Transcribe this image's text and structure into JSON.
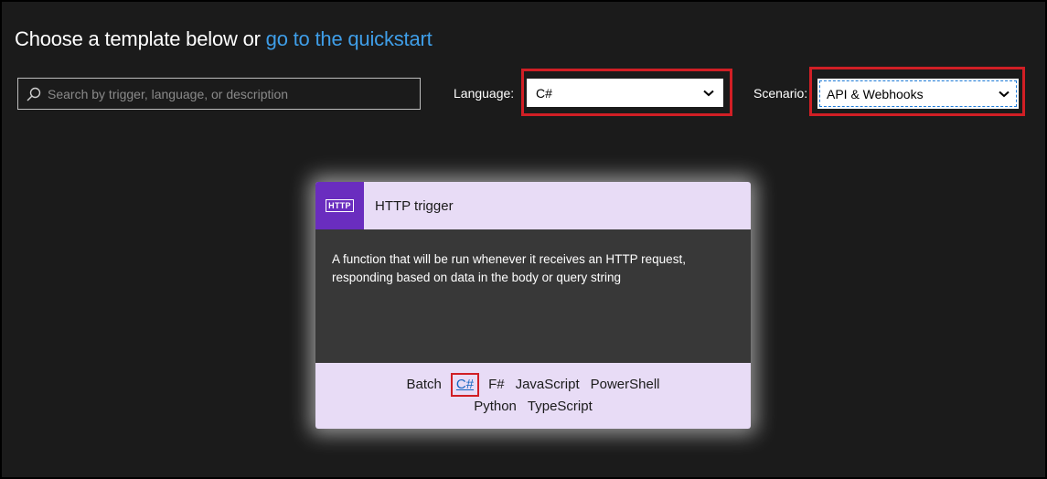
{
  "header": {
    "prefix": "Choose a template below or ",
    "link": "go to the quickstart"
  },
  "search": {
    "placeholder": "Search by trigger, language, or description",
    "value": ""
  },
  "filters": {
    "language_label": "Language:",
    "language_value": "C#",
    "scenario_label": "Scenario:",
    "scenario_value": "API & Webhooks"
  },
  "card": {
    "badge": "HTTP",
    "title": "HTTP trigger",
    "description": "A function that will be run whenever it receives an HTTP request, responding based on data in the body or query string",
    "languages": [
      "Batch",
      "C#",
      "F#",
      "JavaScript",
      "PowerShell",
      "Python",
      "TypeScript"
    ]
  },
  "colors": {
    "background": "#1b1b1b",
    "link": "#3f9ee8",
    "highlight_red": "#d11f25",
    "card_header": "#e8dcf6",
    "badge_purple": "#6a2dbf"
  },
  "icons": [
    "search-icon",
    "chevron-down-icon"
  ]
}
